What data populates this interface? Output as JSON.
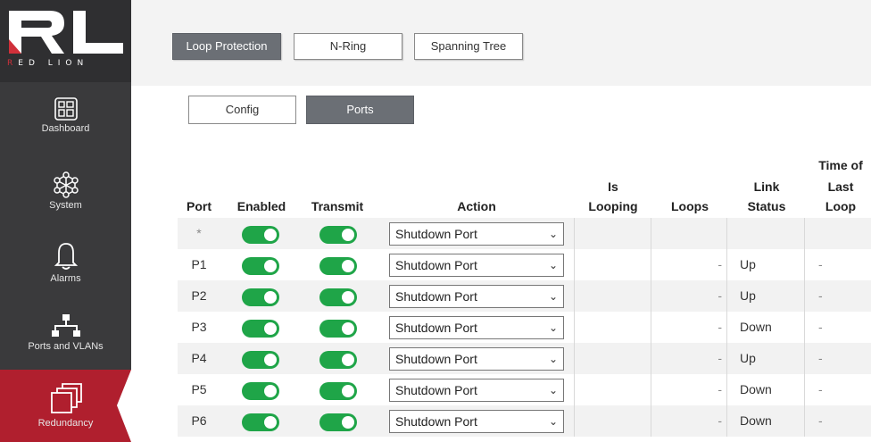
{
  "brand": {
    "logo_text": "RED LION"
  },
  "sidebar": {
    "items": [
      {
        "label": "Dashboard",
        "icon": "dashboard-icon"
      },
      {
        "label": "System",
        "icon": "system-icon"
      },
      {
        "label": "Alarms",
        "icon": "bell-icon"
      },
      {
        "label": "Ports and VLANs",
        "icon": "network-icon"
      },
      {
        "label": "Redundancy",
        "icon": "windows-stack-icon",
        "active": true
      }
    ]
  },
  "tabs": [
    "Loop Protection",
    "N-Ring",
    "Spanning Tree"
  ],
  "subtabs": [
    "Config",
    "Ports"
  ],
  "table": {
    "headers": {
      "port": "Port",
      "enabled": "Enabled",
      "transmit": "Transmit",
      "action": "Action",
      "is_looping_1": "Is",
      "is_looping_2": "Looping",
      "loops": "Loops",
      "link_status_1": "Link",
      "link_status_2": "Status",
      "time_1": "Time of",
      "time_2": "Last",
      "time_3": "Loop"
    },
    "rows": [
      {
        "port": "*",
        "action": "Shutdown Port",
        "loops": "",
        "link": "",
        "time": ""
      },
      {
        "port": "P1",
        "action": "Shutdown Port",
        "loops": "-",
        "link": "Up",
        "time": "-"
      },
      {
        "port": "P2",
        "action": "Shutdown Port",
        "loops": "-",
        "link": "Up",
        "time": "-"
      },
      {
        "port": "P3",
        "action": "Shutdown Port",
        "loops": "-",
        "link": "Down",
        "time": "-"
      },
      {
        "port": "P4",
        "action": "Shutdown Port",
        "loops": "-",
        "link": "Up",
        "time": "-"
      },
      {
        "port": "P5",
        "action": "Shutdown Port",
        "loops": "-",
        "link": "Down",
        "time": "-"
      },
      {
        "port": "P6",
        "action": "Shutdown Port",
        "loops": "-",
        "link": "Down",
        "time": "-"
      }
    ]
  },
  "colors": {
    "toggle_on": "#1fa548",
    "brand_red": "#b01f2e",
    "sidebar": "#3a3a3c"
  }
}
